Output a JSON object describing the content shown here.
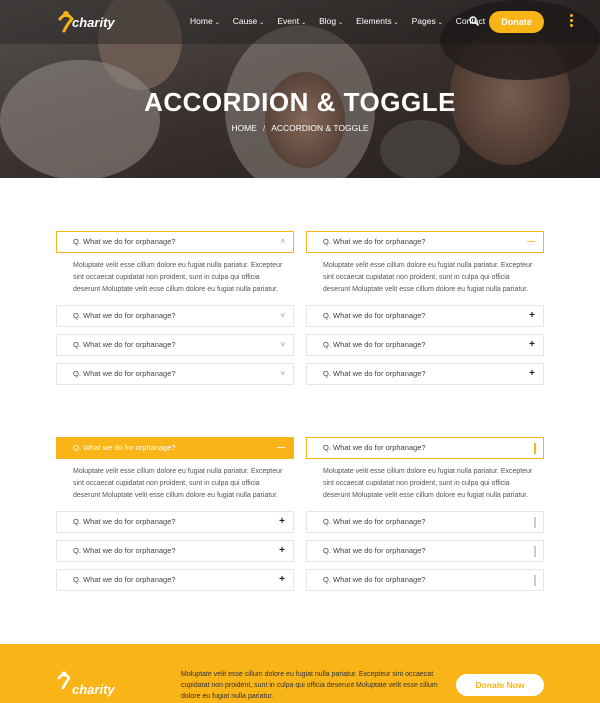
{
  "brand": {
    "name": "charity",
    "accent": "#f9b418"
  },
  "nav": {
    "items": [
      {
        "label": "Home"
      },
      {
        "label": "Cause"
      },
      {
        "label": "Event"
      },
      {
        "label": "Blog"
      },
      {
        "label": "Elements"
      },
      {
        "label": "Pages"
      },
      {
        "label": "Contact"
      }
    ],
    "dropdown_glyph": "⌄",
    "donate_label": "Donate",
    "search_icon": "search-icon",
    "menu_icon": "kebab-menu-icon"
  },
  "hero": {
    "title": "ACCORDION & TOGGLE",
    "breadcrumb": {
      "home": "HOME",
      "separator": "/",
      "current": "ACCORDION & TOGGLE"
    }
  },
  "accordion_question": "Q. What we do for orphanage?",
  "accordion_answer": "Moluptate velit esse cillum dolore eu fugiat nulla pariatur. Excepteur sint occaecat cupidatat non proident, sunt in culpa qui officia deserunt Moluptate velit esse cillum dolore eu fugiat nulla pariatur.",
  "icons": {
    "chevron_up": "˄",
    "chevron_down": "˅",
    "minus": "—",
    "plus": "+"
  },
  "footer": {
    "logo": "charity",
    "text": "Moluptate velit esse cillum dolore eu fugiat nulla pariatur. Excepteur sint occaecat cupidatat non proident, sunt in culpa qui officia deserunt Moluptate velit esse cillum dolore eu fugiat nulla pariatur.",
    "button_label": "Donate Now"
  }
}
